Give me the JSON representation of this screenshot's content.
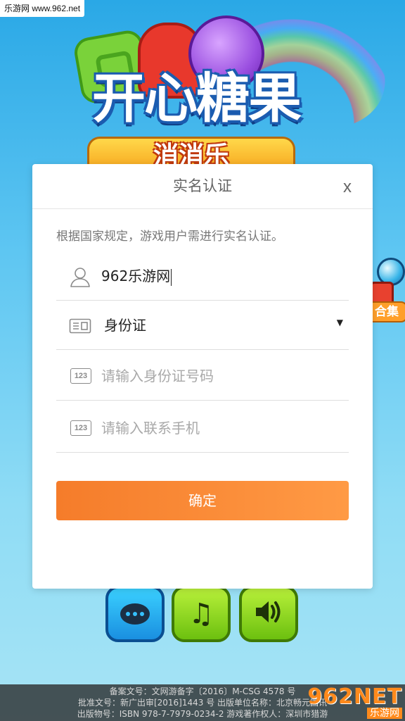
{
  "watermark": {
    "top_text": "乐游网 www.962.net",
    "logo_big": "962NET",
    "logo_small": "乐游网"
  },
  "game": {
    "title": "开心糖果",
    "subtitle": "消消乐",
    "side_badge_label": "合集",
    "buttons": {
      "chat_icon": "chat-bubble-icon",
      "music_icon": "music-note-icon",
      "sound_icon": "speaker-icon"
    }
  },
  "dialog": {
    "title": "实名认证",
    "close_label": "x",
    "notice": "根据国家规定，游戏用户需进行实名认证。",
    "name_field": {
      "icon": "user-icon",
      "value": "962乐游网"
    },
    "id_type_field": {
      "icon": "id-card-icon",
      "value": "身份证",
      "arrow": "▼"
    },
    "id_number_field": {
      "icon": "123",
      "placeholder": "请输入身份证号码"
    },
    "phone_field": {
      "icon": "123",
      "placeholder": "请输入联系手机"
    },
    "confirm_label": "确定"
  },
  "footer": {
    "lines": [
      "备案文号：文网游备字〔2016〕M-CSG 4578 号",
      "批准文号：新广出审[2016]1443 号  出版单位名称：北京畅元国讯",
      "出版物号：ISBN 978-7-7979-0234-2  游戏著作权人：深圳市猎游"
    ]
  }
}
